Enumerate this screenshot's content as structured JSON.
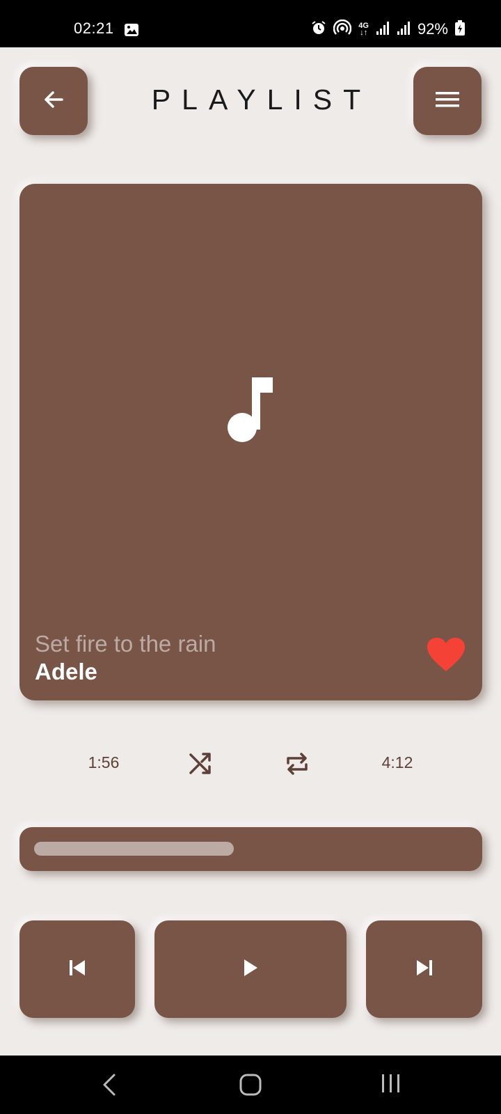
{
  "status_bar": {
    "time": "02:21",
    "network": "4G",
    "battery": "92%",
    "icons": [
      "gallery-icon",
      "alarm-icon",
      "hotspot-icon",
      "signal-icon",
      "signal-icon",
      "battery-charging-icon"
    ]
  },
  "header": {
    "title": "PLAYLIST",
    "back_icon": "arrow-left-icon",
    "menu_icon": "hamburger-menu-icon"
  },
  "now_playing": {
    "song_title": "Set fire to the rain",
    "artist": "Adele",
    "cover_icon": "music-note-icon",
    "favorite": true,
    "favorite_icon": "heart-icon"
  },
  "controls": {
    "current_time": "1:56",
    "total_time": "4:12",
    "shuffle_icon": "shuffle-icon",
    "repeat_icon": "repeat-icon",
    "progress_fraction": 0.46
  },
  "playback": {
    "previous_icon": "skip-previous-icon",
    "play_icon": "play-icon",
    "next_icon": "skip-next-icon"
  },
  "colors": {
    "background": "#EFEBE9",
    "primary": "#795548",
    "accent_heart": "#F44336",
    "muted_text": "#BCAAA4",
    "time_text": "#5D4037"
  },
  "nav_bar": {
    "icons": [
      "nav-back-icon",
      "nav-home-icon",
      "nav-recents-icon"
    ]
  }
}
